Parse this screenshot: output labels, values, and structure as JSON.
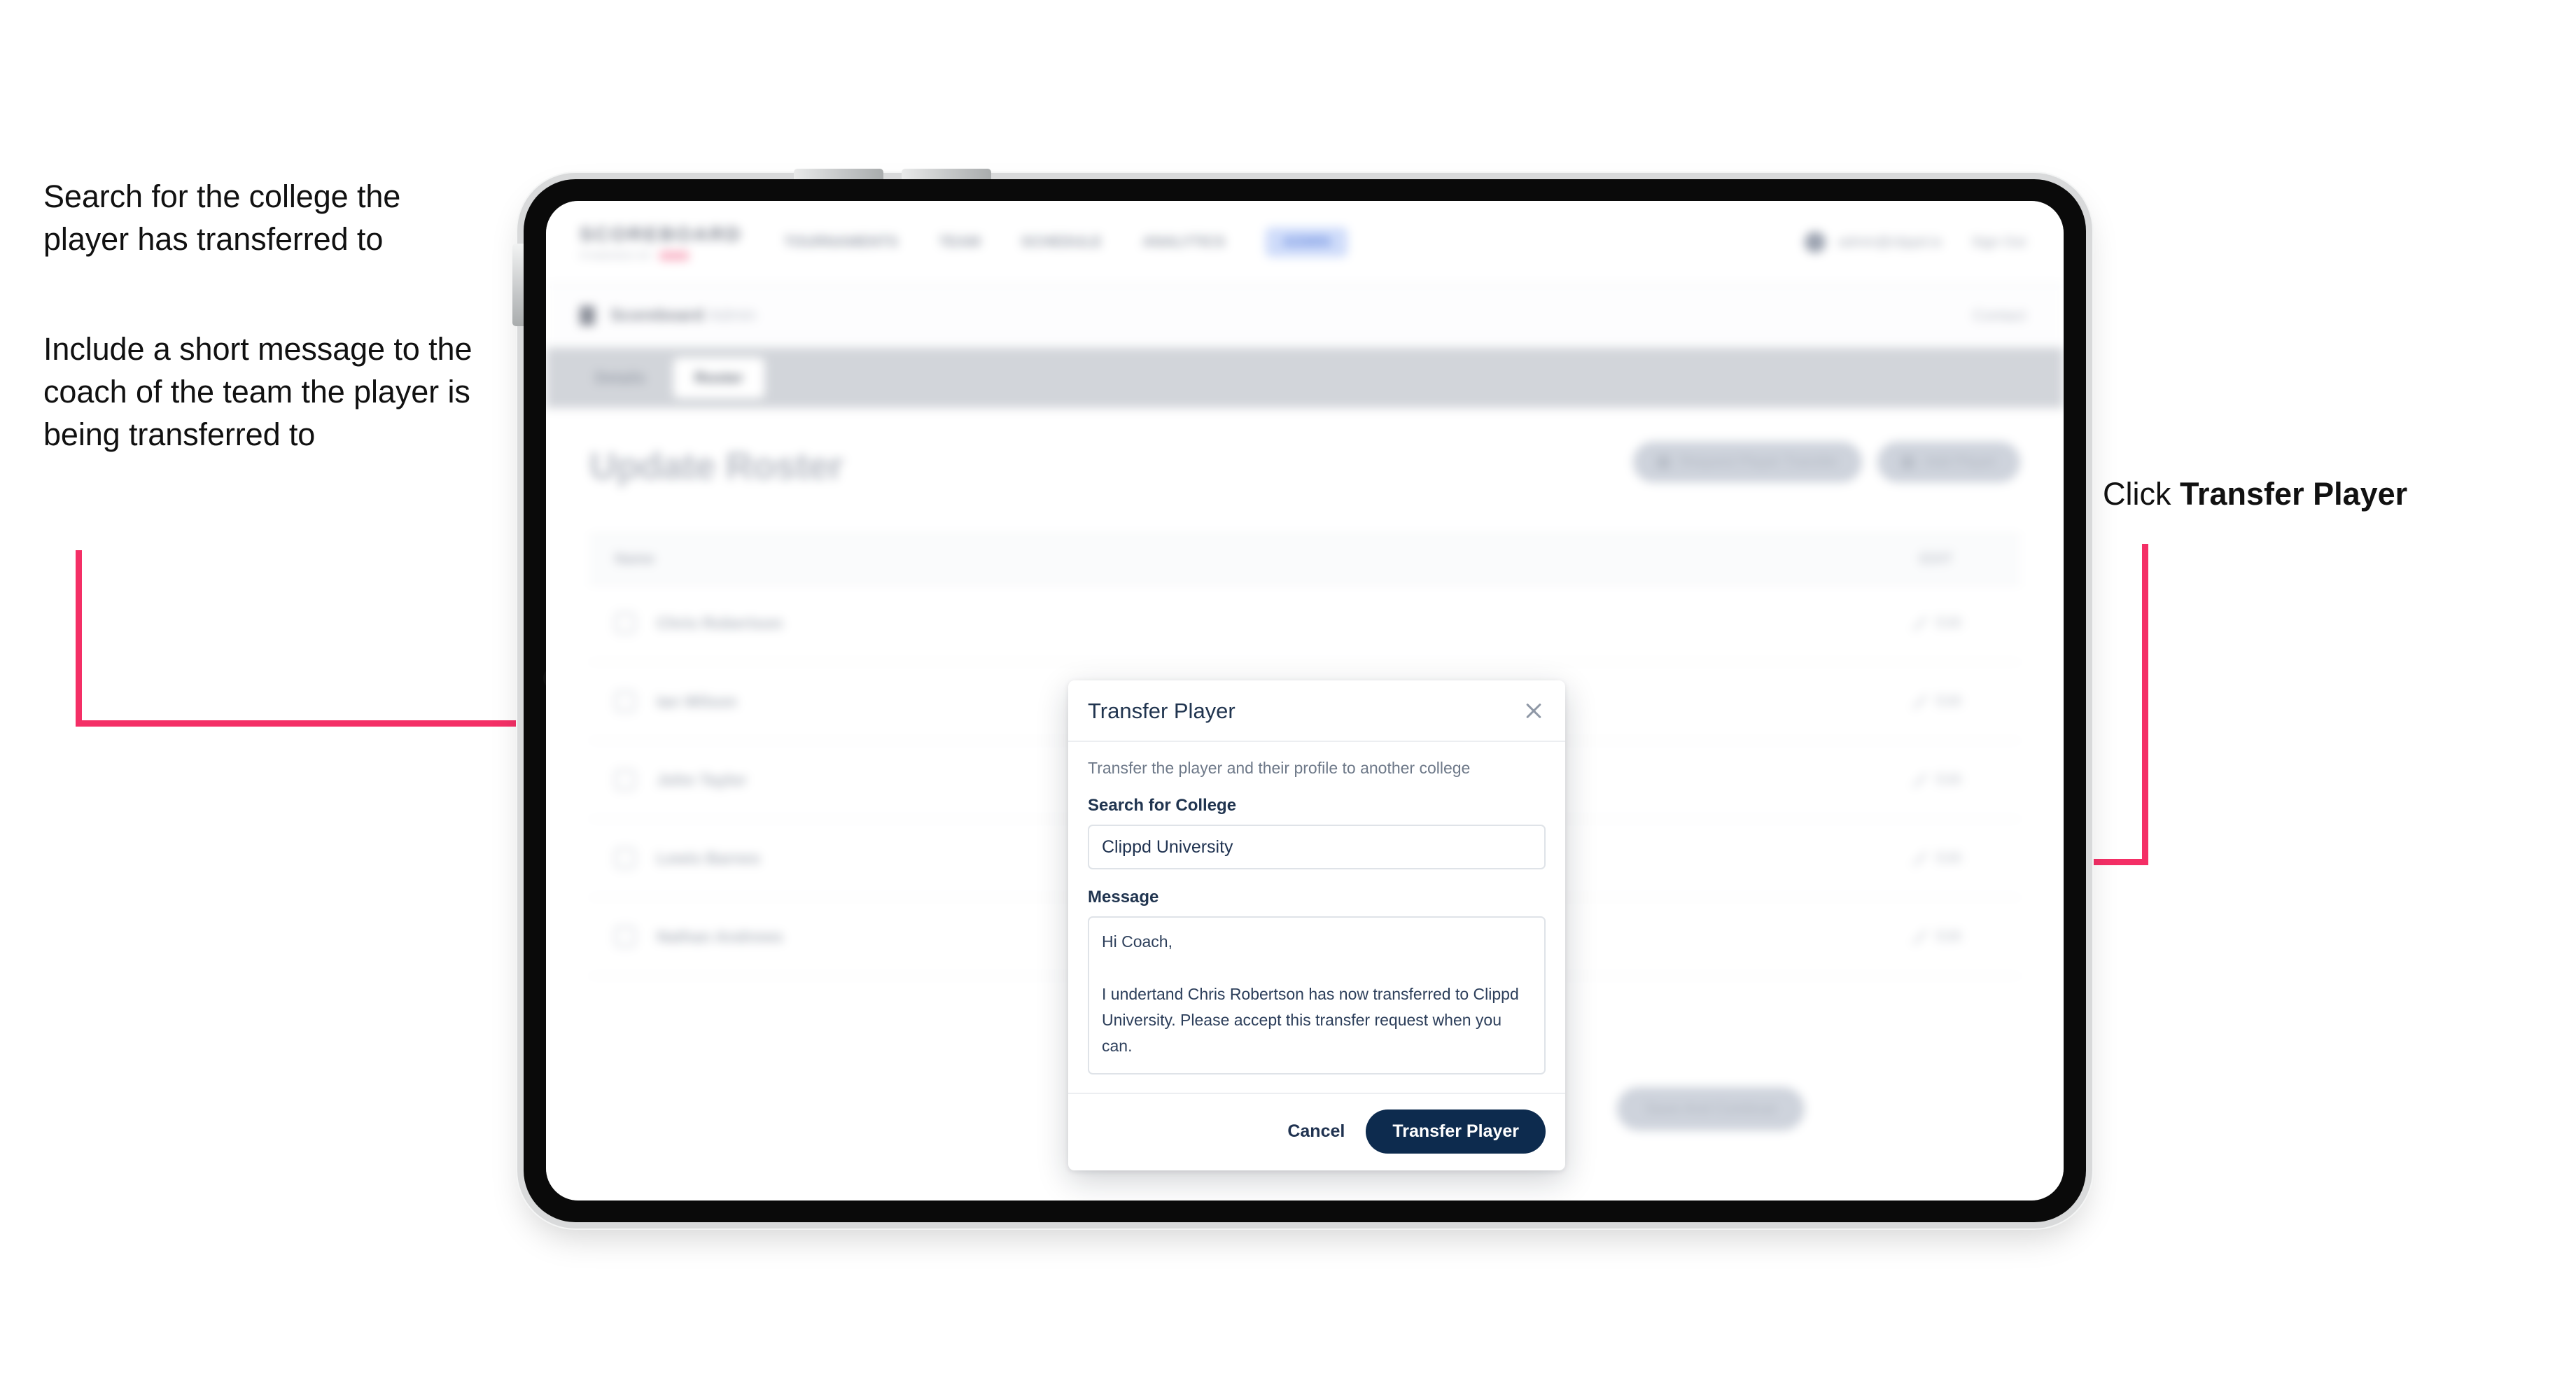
{
  "annotations": {
    "left_1": "Search for the college the player has transferred to",
    "left_2": "Include a short message to the coach of the team the player is being transferred to",
    "right_prefix": "Click ",
    "right_bold": "Transfer Player"
  },
  "colors": {
    "accent_pink": "#F42F66",
    "primary_navy": "#0D2B4E",
    "modal_title": "#20344F"
  },
  "app": {
    "topnav": {
      "brand_mark": "SCOREBOARD",
      "brand_sub": "POWERED BY",
      "links": [
        "TOURNAMENTS",
        "TEAM",
        "SCHEDULE",
        "ANALYTICS"
      ],
      "pill": "ADMIN",
      "user": "admin@clippd.io",
      "signout": "Sign Out"
    },
    "breadcrumb": {
      "title": "Scoreboard",
      "muted": "Admin",
      "right": "Contact"
    },
    "tabs": [
      {
        "label": "Details",
        "active": false
      },
      {
        "label": "Roster",
        "active": true
      }
    ],
    "page": {
      "title": "Update Roster",
      "header_actions": [
        "Request Player Transfer",
        "Add Player"
      ],
      "bottom_action": "Save And Continue"
    },
    "roster": {
      "columns": {
        "name": "Name",
        "edit": "EDIT"
      },
      "rows": [
        {
          "name": "Chris Robertson",
          "edit": "Edit"
        },
        {
          "name": "Ian Wilson",
          "edit": "Edit"
        },
        {
          "name": "John Taylor",
          "edit": "Edit"
        },
        {
          "name": "Lewis Barnes",
          "edit": "Edit"
        },
        {
          "name": "Nathan Andrews",
          "edit": "Edit"
        }
      ]
    }
  },
  "modal": {
    "title": "Transfer Player",
    "close_icon": "close-icon",
    "description": "Transfer the player and their profile to another college",
    "college_label": "Search for College",
    "college_value": "Clippd University",
    "college_placeholder": "Search for College",
    "message_label": "Message",
    "message_value": "Hi Coach,\n\nI undertand Chris Robertson has now transferred to Clippd University. Please accept this transfer request when you can.",
    "message_placeholder": "Message",
    "cancel_label": "Cancel",
    "submit_label": "Transfer Player"
  }
}
